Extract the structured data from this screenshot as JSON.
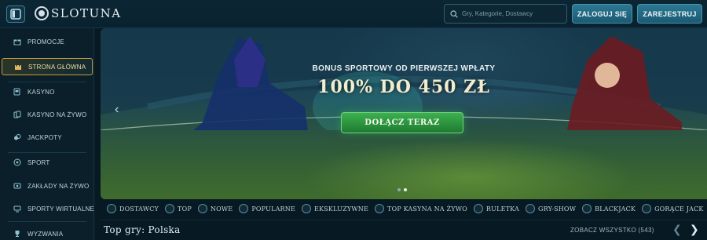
{
  "brand": {
    "name": "SLOTUNA"
  },
  "header": {
    "search_placeholder": "Gry, Kategorie, Dostawcy",
    "login_label": "ZALOGUJ SIĘ",
    "register_label": "ZAREJESTRUJ"
  },
  "sidebar": {
    "items": [
      {
        "label": "PROMOCJE",
        "icon": "gift-icon"
      },
      {
        "label": "STRONA GŁÓWNA",
        "icon": "castle-icon",
        "active": true
      },
      {
        "label": "KASYNO",
        "icon": "slot-machine-icon"
      },
      {
        "label": "KASYNO NA ŻYWO",
        "icon": "cards-icon"
      },
      {
        "label": "JACKPOTY",
        "icon": "coins-icon"
      },
      {
        "label": "SPORT",
        "icon": "ball-icon"
      },
      {
        "label": "ZAKŁADY NA ŻYWO",
        "icon": "live-bet-icon"
      },
      {
        "label": "SPORTY WIRTUALNE",
        "icon": "virtual-sport-icon"
      },
      {
        "label": "WYZWANIA",
        "icon": "trophy-icon"
      }
    ]
  },
  "banner": {
    "subtitle": "BONUS SPORTOWY OD PIERWSZEJ WPŁATY",
    "headline": "100% DO 450 ZŁ",
    "cta_label": "DOŁĄCZ TERAZ",
    "slides_total": 2,
    "active_slide": 2
  },
  "categories": [
    "DOSTAWCY",
    "TOP",
    "NOWE",
    "POPULARNE",
    "EKSKLUZYWNE",
    "TOP KASYNA NA ŻYWO",
    "RULETKA",
    "GRY-SHOW",
    "BLACKJACK",
    "GORĄCE JACK"
  ],
  "top_games": {
    "title": "Top gry: Polska",
    "see_all": "ZOBACZ WSZYSTKO (543)"
  },
  "colors": {
    "accent": "#2c7893",
    "cta_green": "#2f9a43",
    "active_border": "#c79a3e",
    "background": "#071a24"
  }
}
